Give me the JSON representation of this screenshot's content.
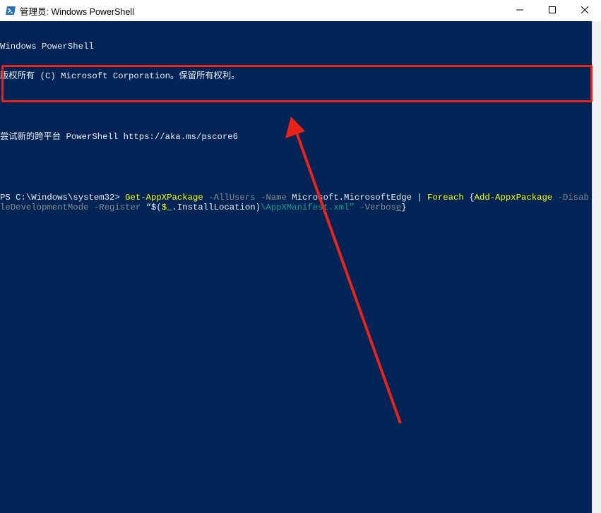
{
  "window": {
    "title": "管理员: Windows PowerShell",
    "icon": "powershell-icon",
    "controls": [
      "minimize-icon",
      "maximize-icon",
      "close-icon"
    ]
  },
  "console": {
    "banner_line1": "Windows PowerShell",
    "banner_line2": "版权所有 (C) Microsoft Corporation。保留所有权利。",
    "banner_line3": "尝试新的跨平台 PowerShell https://aka.ms/pscore6",
    "prompt": "PS C:\\Windows\\system32> ",
    "command_tokens": [
      {
        "text": "Get-AppXPackage",
        "kind": "cmdlet"
      },
      {
        "text": " -AllUsers -Name ",
        "kind": "param"
      },
      {
        "text": "Microsoft.MicrosoftEdge",
        "kind": "arg"
      },
      {
        "text": " | ",
        "kind": "arg"
      },
      {
        "text": "Foreach ",
        "kind": "cmdlet"
      },
      {
        "text": "{",
        "kind": "arg"
      },
      {
        "text": "Add-AppxPackage",
        "kind": "cmdlet"
      },
      {
        "text": " -DisableDevelopmentMode -Register ",
        "kind": "param"
      },
      {
        "text": "“$(",
        "kind": "arg"
      },
      {
        "text": "$_",
        "kind": "cmdlet"
      },
      {
        "text": ".InstallLocation)",
        "kind": "arg"
      },
      {
        "text": "\\AppXManifest.xml”",
        "kind": "string"
      },
      {
        "text": " -Verbos",
        "kind": "param"
      },
      {
        "text": "e",
        "kind": "cursor"
      },
      {
        "text": "}",
        "kind": "arg"
      }
    ]
  },
  "colors": {
    "background": "#012456",
    "text": "#eeedf0",
    "cmdlet": "#ffff00",
    "param": "#8c8c8c",
    "string": "#1f9d86",
    "annotation": "#e8241a"
  },
  "annotation": {
    "highlight": "red-box-around-command",
    "arrow": "red-arrow-pointing-to-command"
  }
}
